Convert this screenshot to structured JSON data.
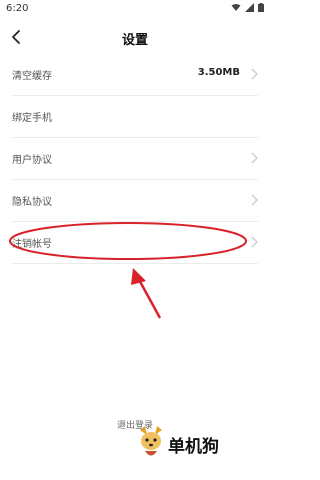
{
  "status_bar": {
    "time": "6:20"
  },
  "header": {
    "title": "设置"
  },
  "settings": {
    "clear_cache_label": "清空缓存",
    "cache_size": "3.50MB",
    "bind_phone_label": "绑定手机",
    "user_agreement_label": "用户协议",
    "privacy_label": "隐私协议",
    "cancel_account_label": "注销帐号"
  },
  "footer": {
    "logout_label": "退出登录"
  },
  "watermark": {
    "text": "单机狗"
  },
  "colors": {
    "annotation": "#d9232a",
    "divider": "#ececec",
    "chevron": "#c8c8c8"
  }
}
